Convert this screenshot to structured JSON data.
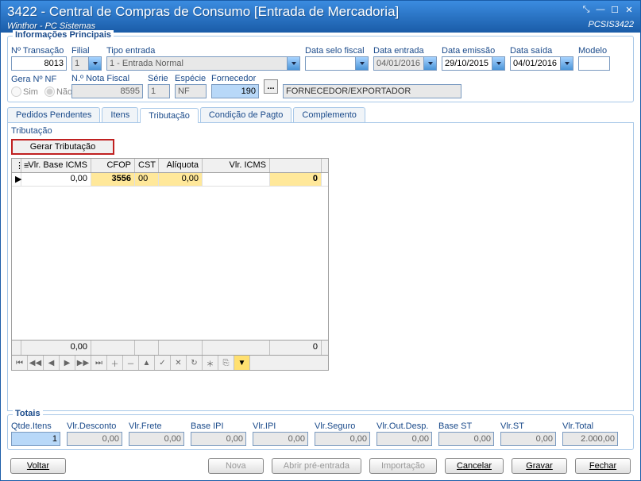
{
  "window": {
    "title": "3422 - Central de Compras de Consumo [Entrada de Mercadoria]",
    "subtitle": "Winthor - PC Sistemas",
    "code": "PCSIS3422"
  },
  "principais": {
    "legend": "Informações Principais",
    "labels": {
      "ntrans": "Nº Transação",
      "filial": "Filial",
      "tipoentrada": "Tipo entrada",
      "dataselo": "Data selo fiscal",
      "dataentrada": "Data entrada",
      "dataemissao": "Data emissão",
      "datasaida": "Data saída",
      "modelo": "Modelo",
      "geranf": "Gera Nº NF",
      "nnotafiscal": "N.º Nota Fiscal",
      "serie": "Série",
      "especie": "Espécie",
      "fornecedor": "Fornecedor"
    },
    "values": {
      "ntrans": "8013",
      "filial": "1",
      "tipoentrada": "1 - Entrada Normal",
      "dataselo": "",
      "dataentrada": "04/01/2016",
      "dataemissao": "29/10/2015",
      "datasaida": "04/01/2016",
      "modelo": "",
      "nnotafiscal": "8595",
      "serie": "1",
      "especie": "NF",
      "fornecedor_cod": "190",
      "fornecedor_nome": "FORNECEDOR/EXPORTADOR",
      "sim": "Sim",
      "nao": "Não"
    }
  },
  "tabs": {
    "pedidos": "Pedidos Pendentes",
    "itens": "Itens",
    "tributacao": "Tributação",
    "condpagto": "Condição de Pagto",
    "complemento": "Complemento"
  },
  "tributacao": {
    "label": "Tributação",
    "gerar": "Gerar Tributação",
    "cols": {
      "base": "Vlr. Base ICMS",
      "cfop": "CFOP",
      "cst": "CST",
      "aliq": "Alíquota",
      "icms": "Vlr. ICMS"
    },
    "row": {
      "base": "0,00",
      "cfop": "3556",
      "cst": "00",
      "aliq": "0,00",
      "icms": "",
      "last": "0"
    },
    "footer": {
      "base": "0,00",
      "icms": "",
      "last": "0"
    }
  },
  "totais": {
    "legend": "Totais",
    "labels": {
      "qtde": "Qtde.Itens",
      "desconto": "Vlr.Desconto",
      "frete": "Vlr.Frete",
      "baseipi": "Base IPI",
      "ipi": "Vlr.IPI",
      "seguro": "Vlr.Seguro",
      "outdesp": "Vlr.Out.Desp.",
      "basest": "Base ST",
      "st": "Vlr.ST",
      "total": "Vlr.Total"
    },
    "values": {
      "qtde": "1",
      "desconto": "0,00",
      "frete": "0,00",
      "baseipi": "0,00",
      "ipi": "0,00",
      "seguro": "0,00",
      "outdesp": "0,00",
      "basest": "0,00",
      "st": "0,00",
      "total": "2.000,00"
    }
  },
  "buttons": {
    "voltar": "Voltar",
    "nova": "Nova",
    "abrir": "Abrir pré-entrada",
    "importacao": "Importação",
    "cancelar": "Cancelar",
    "gravar": "Gravar",
    "fechar": "Fechar"
  }
}
